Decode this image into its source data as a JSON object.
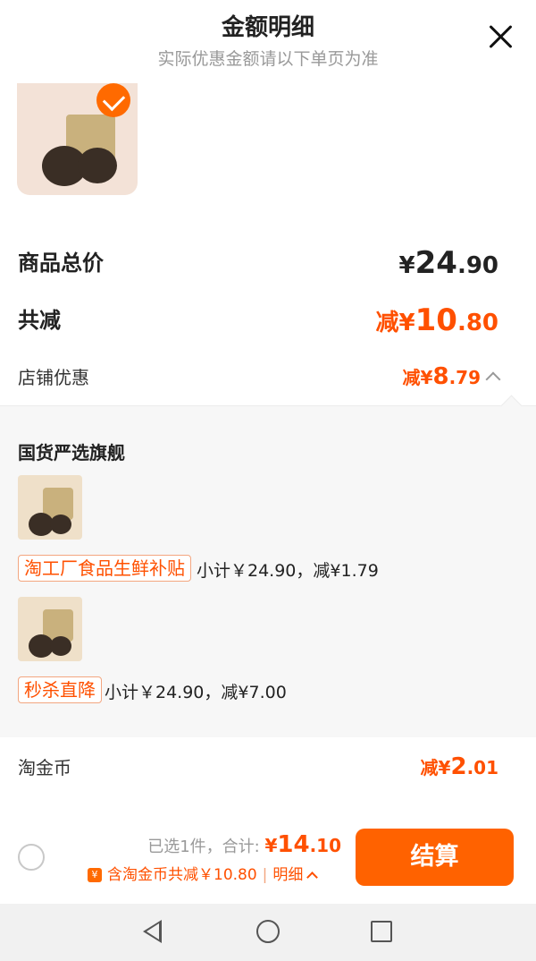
{
  "header": {
    "title": "金额明细",
    "subtitle": "实际优惠金额请以下单页为准"
  },
  "product": {
    "selected": true
  },
  "summary_rows": {
    "total_label": "商品总价",
    "total_currency": "¥",
    "total_int": "24",
    "total_dec": ".90",
    "discount_label": "共减",
    "discount_prefix": "减¥",
    "discount_int": "10",
    "discount_dec": ".80",
    "shop_discount_label": "店铺优惠",
    "shop_discount_prefix": "减¥",
    "shop_discount_int": "8",
    "shop_discount_dec": ".79"
  },
  "shop": {
    "name": "国货严选旗舰",
    "items": [
      {
        "tag": "淘工厂食品生鲜补贴",
        "detail": "小计￥24.90，减¥1.79"
      },
      {
        "tag": "秒杀直降",
        "detail": "小计￥24.90，减¥7.00"
      }
    ]
  },
  "coins_row": {
    "label": "淘金币",
    "prefix": "减¥",
    "int": "2",
    "dec": ".01"
  },
  "bottom_bar": {
    "selected_text": "已选1件，合计: ",
    "total_currency": "¥",
    "total_int": "14",
    "total_dec": ".10",
    "coin_badge": "¥",
    "coin_text": "含淘金币共减￥10.80",
    "detail_label": "明细",
    "checkout_label": "结算"
  },
  "colors": {
    "accent": "#ff5000",
    "checkout": "#ff6200"
  }
}
